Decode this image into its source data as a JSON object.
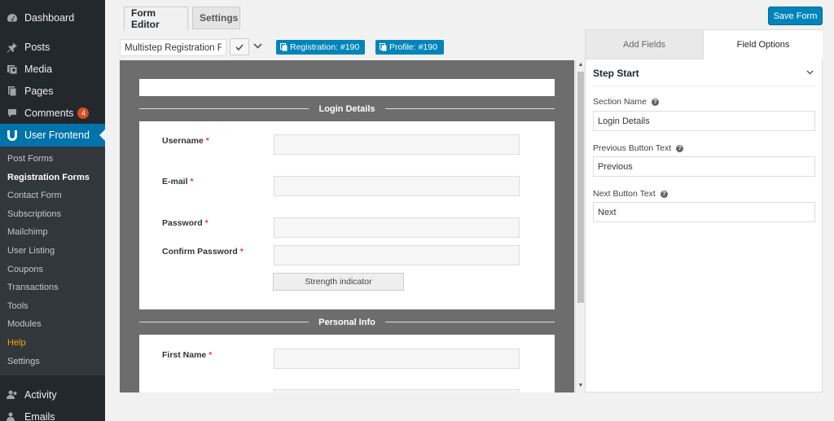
{
  "sidebar": {
    "top_items": [
      {
        "label": "Dashboard",
        "icon": "dashboard-icon"
      },
      {
        "label": "Posts",
        "icon": "pushpin-icon"
      },
      {
        "label": "Media",
        "icon": "media-icon"
      },
      {
        "label": "Pages",
        "icon": "pages-icon"
      },
      {
        "label": "Comments",
        "icon": "comments-icon",
        "badge": "4"
      },
      {
        "label": "User Frontend",
        "icon": "user-frontend-logo-icon"
      }
    ],
    "submenu": [
      "Post Forms",
      "Registration Forms",
      "Contact Form",
      "Subscriptions",
      "Mailchimp",
      "User Listing",
      "Coupons",
      "Transactions",
      "Tools",
      "Modules",
      "Help",
      "Settings"
    ],
    "bottom_items": [
      {
        "label": "Activity",
        "icon": "activity-icon"
      },
      {
        "label": "Emails",
        "icon": "emails-icon"
      }
    ]
  },
  "header": {
    "tabs": [
      "Form Editor",
      "Settings"
    ],
    "save_label": "Save Form",
    "form_title": "Multistep Registration Form",
    "shortcodes": [
      "Registration: #190",
      "Profile: #190"
    ]
  },
  "preview": {
    "sections": [
      "Login Details",
      "Personal Info"
    ],
    "fields": [
      {
        "label": "Username",
        "req": "*"
      },
      {
        "label": "E-mail",
        "req": "*"
      },
      {
        "label": "Password",
        "req": "*"
      },
      {
        "label": "Confirm Password",
        "req": "*"
      },
      {
        "label": "First Name",
        "req": "*"
      }
    ],
    "strength_label": "Strength indicator"
  },
  "panel": {
    "tabs": [
      "Add Fields",
      "Field Options"
    ],
    "step_title": "Step Start",
    "options": [
      {
        "label": "Section Name",
        "value": "Login Details"
      },
      {
        "label": "Previous Button Text",
        "value": "Previous"
      },
      {
        "label": "Next Button Text",
        "value": "Next"
      }
    ]
  },
  "colors": {
    "admin_bg": "#23282d",
    "accent": "#0073aa",
    "button": "#0085ba",
    "required": "#e33333",
    "help_link": "#f0a30a"
  }
}
